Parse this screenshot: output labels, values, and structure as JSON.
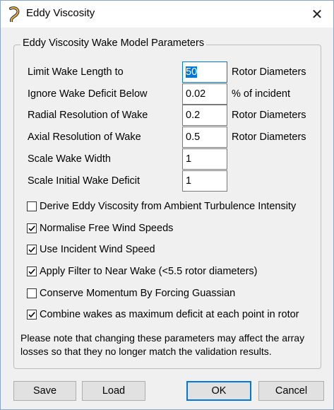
{
  "window": {
    "title": "Eddy Viscosity"
  },
  "group": {
    "title": "Eddy Viscosity Wake Model Parameters"
  },
  "params": [
    {
      "label": "Limit Wake Length to",
      "value": "50",
      "unit": "Rotor Diameters"
    },
    {
      "label": "Ignore Wake Deficit Below",
      "value": "0.02",
      "unit": "% of incident"
    },
    {
      "label": "Radial Resolution of Wake",
      "value": "0.2",
      "unit": "Rotor Diameters"
    },
    {
      "label": "Axial Resolution of Wake",
      "value": "0.5",
      "unit": "Rotor Diameters"
    },
    {
      "label": "Scale Wake Width",
      "value": "1",
      "unit": ""
    },
    {
      "label": "Scale Initial Wake Deficit",
      "value": "1",
      "unit": ""
    }
  ],
  "options": [
    {
      "label": "Derive Eddy Viscosity from Ambient Turbulence Intensity",
      "checked": false
    },
    {
      "label": "Normalise Free Wind Speeds",
      "checked": true
    },
    {
      "label": "Use Incident Wind Speed",
      "checked": true
    },
    {
      "label": "Apply Filter to Near Wake (<5.5 rotor diameters)",
      "checked": true
    },
    {
      "label": "Conserve Momentum By Forcing Guassian",
      "checked": false
    },
    {
      "label": "Combine wakes as maximum deficit at each point in rotor",
      "checked": true
    }
  ],
  "note": {
    "text": "Please note that changing these parameters may affect the array losses so that they no longer match the validation results."
  },
  "buttons": {
    "save": "Save",
    "load": "Load",
    "ok": "OK",
    "cancel": "Cancel"
  },
  "colors": {
    "accent": "#0078d7",
    "icon_yellow": "#f3b51f",
    "icon_navy": "#1f2a5c"
  }
}
